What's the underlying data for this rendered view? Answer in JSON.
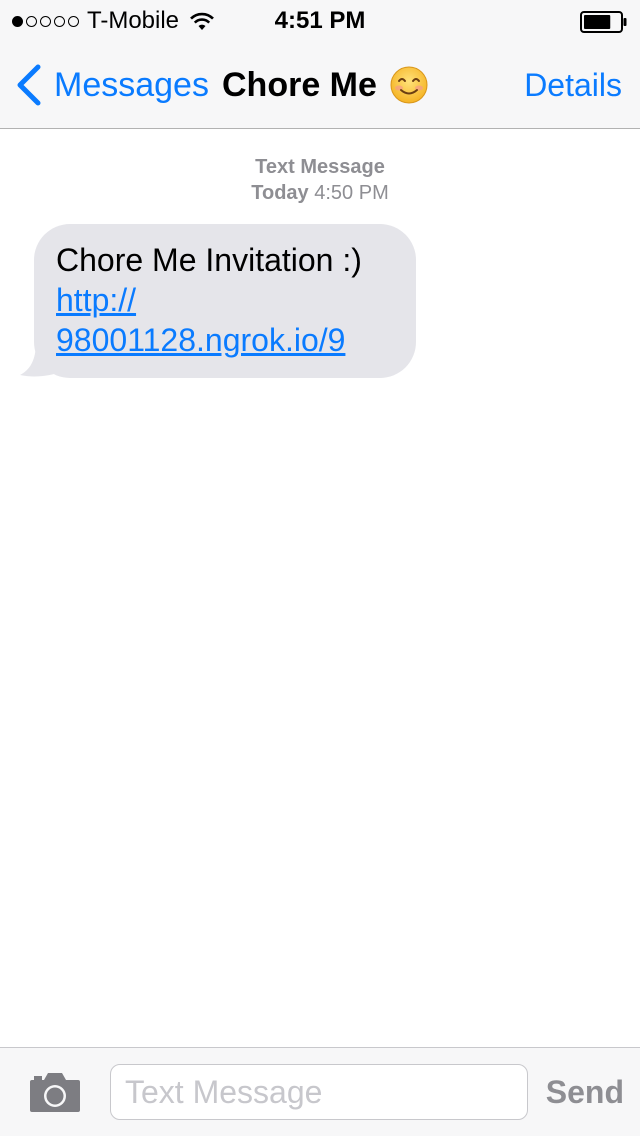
{
  "status_bar": {
    "carrier": "T-Mobile",
    "signal_bars_filled": 1,
    "signal_bars_total": 5,
    "time": "4:51 PM",
    "battery_level": 0.75
  },
  "nav": {
    "back_label": "Messages",
    "title": "Chore Me",
    "title_emoji_icon": "smiling-face-icon",
    "details_label": "Details"
  },
  "conversation": {
    "service_label": "Text Message",
    "day_label": "Today",
    "time_label": "4:50 PM",
    "messages": [
      {
        "direction": "incoming",
        "text": "Chore Me Invitation :)",
        "link_line1": "http://",
        "link_line2": "98001128.ngrok.io/9"
      }
    ]
  },
  "composer": {
    "placeholder": "Text Message",
    "value": "",
    "send_label": "Send",
    "camera_icon": "camera-icon"
  },
  "colors": {
    "accent": "#0a7bff",
    "bubble_incoming": "#e5e5ea",
    "meta_text": "#8e8e93"
  }
}
